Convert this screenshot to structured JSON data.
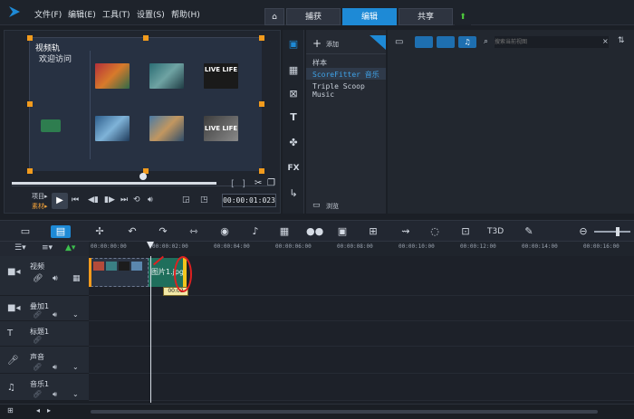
{
  "menu": {
    "items": [
      "文件(F)",
      "编辑(E)",
      "工具(T)",
      "设置(S)",
      "帮助(H)"
    ]
  },
  "tabs": {
    "home_icon": "home-icon",
    "items": [
      "捕获",
      "编辑",
      "共享"
    ],
    "active": "编辑",
    "upload_icon": "upload-arrow-icon"
  },
  "preview": {
    "stage_label": "视频轨",
    "welcome_title": "欢迎访问",
    "thumb_texts": [
      "LIVE LIFE",
      "LIVE LIFE"
    ],
    "mode_project": "项目▸",
    "mode_clip": "素材▸",
    "timecode": "00:00:01:023",
    "bracket_in": "[",
    "bracket_out": "]"
  },
  "library": {
    "add_label": "添加",
    "tree": [
      "样本",
      "ScoreFitter 音乐",
      "Triple Scoop Music"
    ],
    "selected": "ScoreFitter 音乐",
    "browse_label": "浏览",
    "search_placeholder": "搜索当前视图"
  },
  "timeline": {
    "ruler_ticks": [
      "00:00:00:00",
      "00:00:02:00",
      "00:00:04:00",
      "00:00:06:00",
      "00:00:08:00",
      "00:00:10:00",
      "00:00:12:00",
      "00:00:14:00",
      "00:00:16:00"
    ],
    "tracks": [
      {
        "name": "视频"
      },
      {
        "name": "叠加1"
      },
      {
        "name": "标题1"
      },
      {
        "name": "声音"
      },
      {
        "name": "音乐1"
      }
    ],
    "clip_label": "图片1.jpg",
    "clip_duration": "00:02"
  },
  "colors": {
    "accent": "#1e8ad6",
    "handle": "#f29b1d",
    "clip_green": "#1f6f5c",
    "annotation_red": "#e02020"
  }
}
